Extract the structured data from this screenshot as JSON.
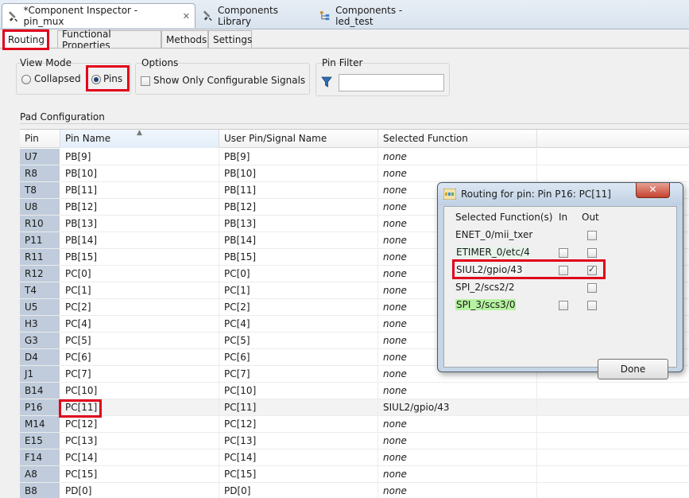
{
  "editor_tabs": [
    {
      "label": "*Component Inspector - pin_mux",
      "close": "✕"
    },
    {
      "label": "Components Library"
    },
    {
      "label": "Components - led_test"
    }
  ],
  "inner_tabs": [
    "Routing",
    "Functional Properties",
    "Methods",
    "Settings"
  ],
  "view_mode": {
    "title": "View Mode",
    "collapsed": "Collapsed",
    "pins": "Pins"
  },
  "options": {
    "title": "Options",
    "show_only": "Show Only Configurable Signals"
  },
  "pin_filter": {
    "title": "Pin Filter",
    "value": ""
  },
  "pad_config": {
    "title": "Pad Configuration",
    "columns": [
      "Pin",
      "Pin Name",
      "User Pin/Signal Name",
      "Selected Function"
    ],
    "sort_indicator": "▲",
    "rows": [
      {
        "pin": "U7",
        "name": "PB[9]",
        "user": "PB[9]",
        "func": "none"
      },
      {
        "pin": "R8",
        "name": "PB[10]",
        "user": "PB[10]",
        "func": "none"
      },
      {
        "pin": "T8",
        "name": "PB[11]",
        "user": "PB[11]",
        "func": "none"
      },
      {
        "pin": "U8",
        "name": "PB[12]",
        "user": "PB[12]",
        "func": "none"
      },
      {
        "pin": "R10",
        "name": "PB[13]",
        "user": "PB[13]",
        "func": "none"
      },
      {
        "pin": "P11",
        "name": "PB[14]",
        "user": "PB[14]",
        "func": "none"
      },
      {
        "pin": "R11",
        "name": "PB[15]",
        "user": "PB[15]",
        "func": "none"
      },
      {
        "pin": "R12",
        "name": "PC[0]",
        "user": "PC[0]",
        "func": "none"
      },
      {
        "pin": "T4",
        "name": "PC[1]",
        "user": "PC[1]",
        "func": "none"
      },
      {
        "pin": "U5",
        "name": "PC[2]",
        "user": "PC[2]",
        "func": "none"
      },
      {
        "pin": "H3",
        "name": "PC[4]",
        "user": "PC[4]",
        "func": "none"
      },
      {
        "pin": "G3",
        "name": "PC[5]",
        "user": "PC[5]",
        "func": "none"
      },
      {
        "pin": "D4",
        "name": "PC[6]",
        "user": "PC[6]",
        "func": "none"
      },
      {
        "pin": "J1",
        "name": "PC[7]",
        "user": "PC[7]",
        "func": "none"
      },
      {
        "pin": "B14",
        "name": "PC[10]",
        "user": "PC[10]",
        "func": "none"
      },
      {
        "pin": "P16",
        "name": "PC[11]",
        "user": "PC[11]",
        "func": "SIUL2/gpio/43"
      },
      {
        "pin": "M14",
        "name": "PC[12]",
        "user": "PC[12]",
        "func": "none"
      },
      {
        "pin": "E15",
        "name": "PC[13]",
        "user": "PC[13]",
        "func": "none"
      },
      {
        "pin": "F14",
        "name": "PC[14]",
        "user": "PC[14]",
        "func": "none"
      },
      {
        "pin": "A8",
        "name": "PC[15]",
        "user": "PC[15]",
        "func": "none"
      },
      {
        "pin": "B8",
        "name": "PD[0]",
        "user": "PD[0]",
        "func": "none"
      }
    ]
  },
  "dialog": {
    "title": "Routing for pin: Pin P16: PC[11]",
    "close": "✕",
    "headers": {
      "func": "Selected Function(s)",
      "in": "In",
      "out": "Out"
    },
    "functions": [
      {
        "name": "ENET_0/mii_txer",
        "has_in": false,
        "in": false,
        "out": false,
        "bg": ""
      },
      {
        "name": "ETIMER_0/etc/4",
        "has_in": true,
        "in": false,
        "out": false,
        "bg": "#e6f4ea"
      },
      {
        "name": "SIUL2/gpio/43",
        "has_in": true,
        "in": false,
        "out": true,
        "bg": "#f5f5f5"
      },
      {
        "name": "SPI_2/scs2/2",
        "has_in": false,
        "in": false,
        "out": false,
        "bg": ""
      },
      {
        "name": "SPI_3/scs3/0",
        "has_in": true,
        "in": false,
        "out": false,
        "bg": "#b6f2a0"
      }
    ],
    "done": "Done"
  },
  "colors": {
    "highlight": "#e0001b",
    "pin_cell": "#c0ccdb",
    "dialog_frame": "#c5d5e6"
  }
}
